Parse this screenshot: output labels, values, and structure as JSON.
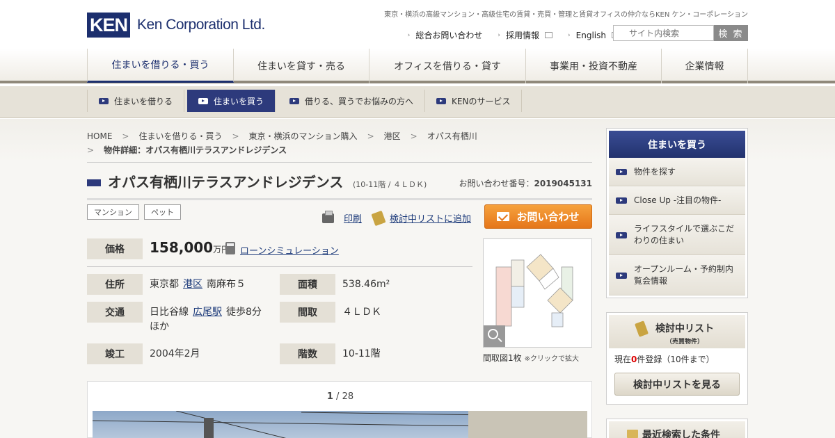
{
  "header": {
    "logo_mark": "KEN",
    "logo_text": "Ken Corporation Ltd.",
    "tagline": "東京・横浜の高級マンション・高級住宅の賃貸・売買・管理と賃貸オフィスの仲介ならKEN ケン・コーポレーション",
    "util_links": [
      "総合お問い合わせ",
      "採用情報",
      "English"
    ],
    "search_placeholder": "サイト内検索",
    "search_button": "検 索"
  },
  "main_nav": [
    {
      "label": "住まいを借りる・買う",
      "width": 211
    },
    {
      "label": "住まいを貸す・売る",
      "width": 195
    },
    {
      "label": "オフィスを借りる・貸す",
      "width": 225
    },
    {
      "label": "事業用・投資不動産",
      "width": 195
    },
    {
      "label": "企業情報",
      "width": 124
    }
  ],
  "sub_nav": [
    "住まいを借りる",
    "住まいを買う",
    "借りる、買うでお悩みの方へ",
    "KENのサービス"
  ],
  "breadcrumb": {
    "items": [
      "HOME",
      "住まいを借りる・買う",
      "東京・横浜のマンション購入",
      "港区",
      "オパス有栖川"
    ],
    "current": "物件詳細：オパス有栖川テラスアンドレジデンス"
  },
  "property": {
    "title": "オパス有栖川テラスアンドレジデンス",
    "subtitle": "(10-11階 / ４ＬＤＫ)",
    "inquiry_label": "お問い合わせ番号：",
    "inquiry_number": "2019045131",
    "tags": [
      "マンション",
      "ペット"
    ],
    "print_label": "印刷",
    "add_list_label": "検討中リストに追加",
    "contact_button": "お問い合わせ",
    "price_label": "価格",
    "price_value": "158,000",
    "price_unit": "万円",
    "loan_link": "ローンシミュレーション",
    "address_label": "住所",
    "address_pref": "東京都",
    "address_ward": "港区",
    "address_rest": "南麻布５",
    "area_label": "面積",
    "area_value": "538.46m²",
    "transit_label": "交通",
    "transit_line": "日比谷線",
    "transit_station": "広尾駅",
    "transit_walk": "徒歩8分",
    "transit_more": "ほか",
    "layout_label": "間取",
    "layout_value": "４ＬＤＫ",
    "built_label": "竣工",
    "built_value": "2004年2月",
    "floor_label": "階数",
    "floor_value": "10-11階",
    "floorplan_caption": "間取図1枚",
    "floorplan_hint": "※クリックで拡大",
    "gallery_current": "1",
    "gallery_total": "28"
  },
  "sidebar": {
    "buy_title": "住まいを買う",
    "buy_items": [
      "物件を探す",
      "Close Up -注目の物件-",
      "ライフスタイルで選ぶこだわりの住まい",
      "オープンルーム・予約制内覧会情報"
    ],
    "list_title": "検討中リスト",
    "list_sub": "（売買物件）",
    "list_count_pre": "現在",
    "list_count_num": "0",
    "list_count_post": "件登録（10件まで）",
    "list_button": "検討中リストを見る",
    "recent_title": "最近検索した条件"
  },
  "colors": {
    "brand_navy": "#1c2f6e",
    "accent_orange": "#e5761a"
  }
}
